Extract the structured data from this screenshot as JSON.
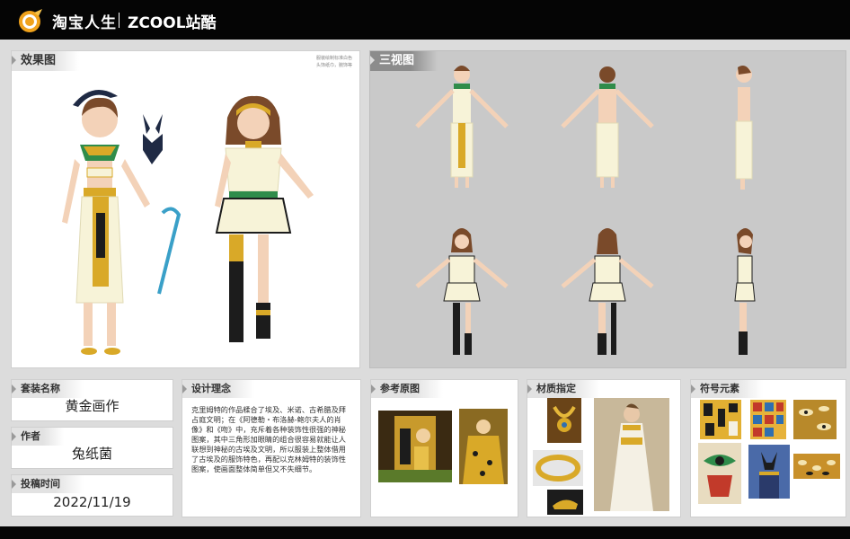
{
  "header": {
    "brand_primary": "淘宝人生",
    "brand_secondary": "ZCOOL站酷"
  },
  "effect_panel": {
    "title": "效果图",
    "note_line1": "服装绘制标准白色",
    "note_line2": "头饰纸巾，腕饰等"
  },
  "views_panel": {
    "title": "三视图"
  },
  "info": {
    "set_name_label": "套装名称",
    "set_name_value": "黄金画作",
    "author_label": "作者",
    "author_value": "兔纸菌",
    "date_label": "投稿时间",
    "date_value": "2022/11/19"
  },
  "concept": {
    "title": "设计理念",
    "text": "克里姆特的作品糅合了埃及、米诺、古希腊及拜占庭文明；在《阿德勒・布洛赫-鲍尔夫人的肖像》和《吻》中，充斥着各种装饰性很强的神秘图案，其中三角形加眼睛的组合很容易就能让人联想到神秘的古埃及文明，所以服装上整体借用了古埃及的服饰特色，再配以克林姆特的装饰性图案，使画面整体简单但又不失细节。"
  },
  "reference": {
    "title": "参考原图"
  },
  "material": {
    "title": "材质指定"
  },
  "symbols": {
    "title": "符号元素"
  },
  "colors": {
    "gold": "#d9a928",
    "cream": "#f7f3d8",
    "green": "#2f8c4a",
    "dark": "#1c1c1c",
    "skin": "#f3d2b8",
    "hair": "#7a4a2a"
  }
}
